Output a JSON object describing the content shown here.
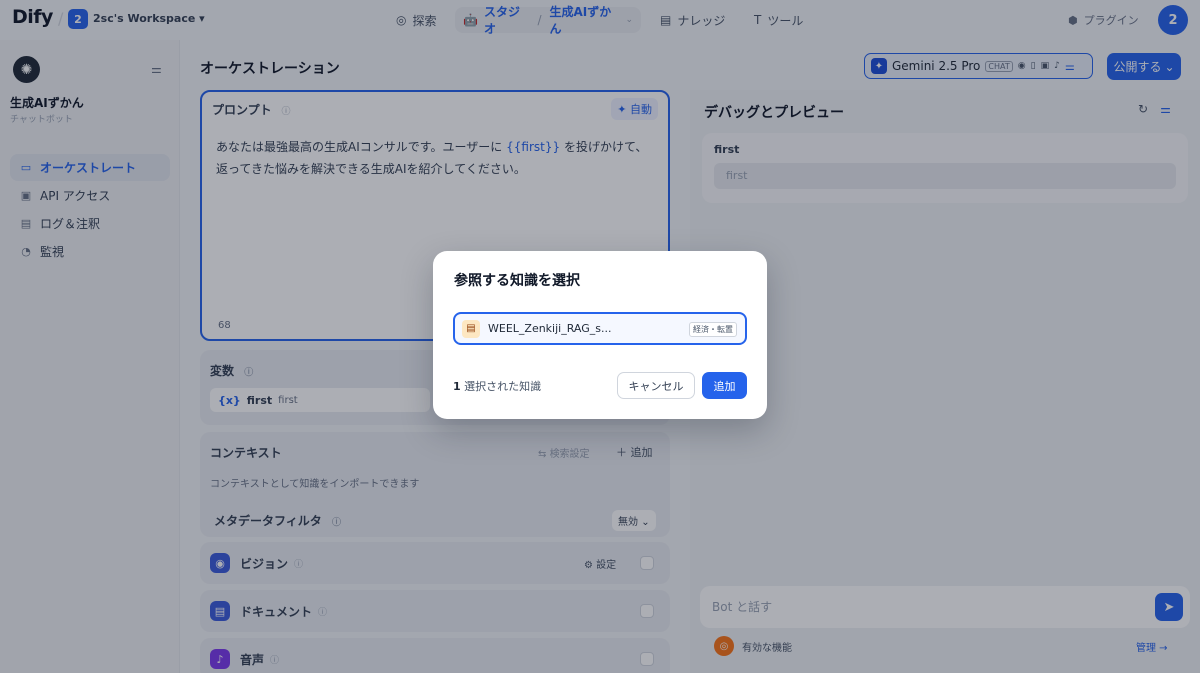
{
  "topbar": {
    "logo": "Dify",
    "workspace_badge": "2",
    "workspace_name": "2sc's Workspace ▾",
    "nav": {
      "explore": "探索",
      "studio": "スタジオ",
      "app": "生成AIずかん",
      "knowledge": "ナレッジ",
      "tools": "ツール"
    },
    "plugins": "プラグイン",
    "avatar": "2"
  },
  "sidebar": {
    "app_name": "生成AIずかん",
    "app_type": "チャットボット",
    "items": [
      {
        "label": "オーケストレート",
        "icon": "orchestrate-icon"
      },
      {
        "label": "API アクセス",
        "icon": "api-icon"
      },
      {
        "label": "ログ＆注釈",
        "icon": "log-icon"
      },
      {
        "label": "監視",
        "icon": "monitor-icon"
      }
    ]
  },
  "header": {
    "title": "オーケストレーション",
    "model_name": "Gemini 2.5 Pro",
    "model_tag": "CHAT",
    "publish": "公開する"
  },
  "prompt": {
    "label": "プロンプト",
    "auto": "自動",
    "text_before": "あなたは最強最高の生成AIコンサルです。ユーザーに",
    "var": "{{first}}",
    "text_after": "を投げかけて、返ってきた悩みを解決できる生成AIを紹介してください。",
    "char_count": "68"
  },
  "variables": {
    "label": "変数",
    "items": [
      {
        "name": "first",
        "description": "first"
      }
    ]
  },
  "context": {
    "label": "コンテキスト",
    "search_settings": "検索設定",
    "add": "追加",
    "hint": "コンテキストとして知識をインポートできます",
    "metadata_filter": "メタデータフィルタ",
    "metadata_value": "無効"
  },
  "features": {
    "vision": "ビジョン",
    "vision_settings": "設定",
    "document": "ドキュメント",
    "audio": "音声"
  },
  "debug": {
    "title": "デバッグとプレビュー",
    "var_label": "first",
    "var_placeholder": "first",
    "chat_placeholder": "Bot と話す",
    "enabled_features": "有効な機能",
    "manage": "管理"
  },
  "modal": {
    "title": "参照する知識を選択",
    "kb_name": "WEEL_Zenkiji_RAG_s...",
    "kb_tag": "経済・転置",
    "selected_count": "1",
    "selected_label": "選択された知識",
    "cancel": "キャンセル",
    "add": "追加"
  },
  "colors": {
    "accent": "#2563eb",
    "overlay": "rgba(16,24,40,0.35)"
  }
}
